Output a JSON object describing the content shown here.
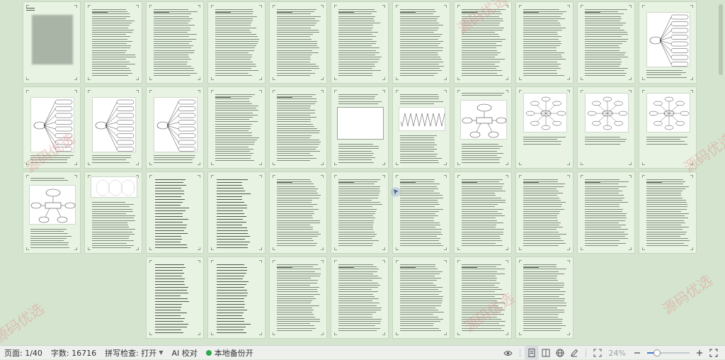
{
  "status_bar": {
    "page_indicator": "页面: 1/40",
    "word_count": "字数: 16716",
    "spell_check": "拼写检查: 打开",
    "ai_proofread": "AI 校对",
    "local_backup": "本地备份开",
    "zoom_level": "24%",
    "zoom_fraction": 0.24
  },
  "watermark": {
    "text": "源码优选"
  },
  "colors": {
    "workspace_bg": "#d5e4cf",
    "page_bg": "#e9f3e4",
    "backup_dot": "#2fa84f",
    "slider_accent": "#4a7bd0"
  },
  "icons": {
    "reading_mode": "eye-icon",
    "page_view": "page-icon",
    "book_view": "book-icon",
    "web_view": "globe-icon",
    "edit_mode": "pen-icon",
    "fit_page": "fit-icon",
    "zoom_out": "minus-icon",
    "zoom_in": "plus-icon",
    "fullscreen": "fullscreen-icon"
  }
}
